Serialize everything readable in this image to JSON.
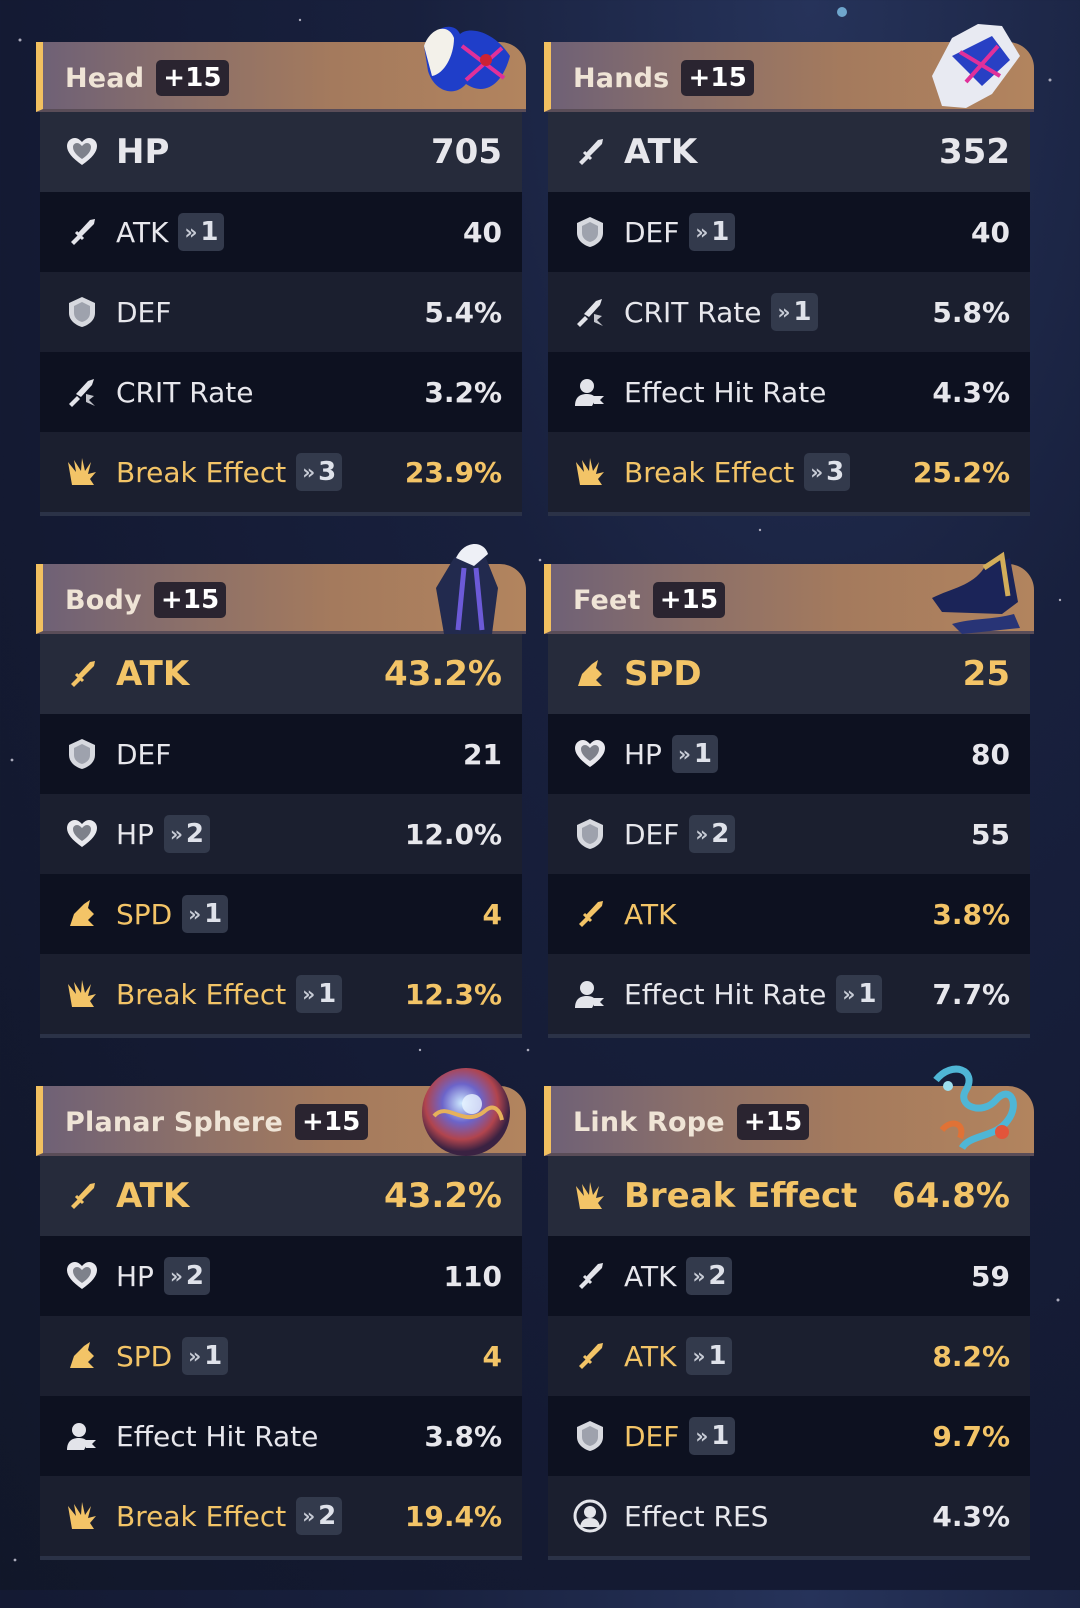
{
  "accent_gold": "#f3c467",
  "relics": [
    {
      "slot": "Head",
      "level": "+15",
      "art_icon": "mask-icon",
      "stats": [
        {
          "icon": "hp-icon",
          "name": "HP",
          "value": "705",
          "rolls": null,
          "highlight": false
        },
        {
          "icon": "atk-icon",
          "name": "ATK",
          "value": "40",
          "rolls": "1",
          "highlight": false
        },
        {
          "icon": "def-icon",
          "name": "DEF",
          "value": "5.4%",
          "rolls": null,
          "highlight": false
        },
        {
          "icon": "crit-rate-icon",
          "name": "CRIT Rate",
          "value": "3.2%",
          "rolls": null,
          "highlight": false
        },
        {
          "icon": "break-effect-icon",
          "name": "Break Effect",
          "value": "23.9%",
          "rolls": "3",
          "highlight": true
        }
      ]
    },
    {
      "slot": "Hands",
      "level": "+15",
      "art_icon": "gloves-icon",
      "stats": [
        {
          "icon": "atk-icon",
          "name": "ATK",
          "value": "352",
          "rolls": null,
          "highlight": false
        },
        {
          "icon": "def-icon",
          "name": "DEF",
          "value": "40",
          "rolls": "1",
          "highlight": false
        },
        {
          "icon": "crit-rate-icon",
          "name": "CRIT Rate",
          "value": "5.8%",
          "rolls": "1",
          "highlight": false
        },
        {
          "icon": "effect-hit-rate-icon",
          "name": "Effect Hit Rate",
          "value": "4.3%",
          "rolls": null,
          "highlight": false
        },
        {
          "icon": "break-effect-icon",
          "name": "Break Effect",
          "value": "25.2%",
          "rolls": "3",
          "highlight": true
        }
      ]
    },
    {
      "slot": "Body",
      "level": "+15",
      "art_icon": "coat-icon",
      "stats": [
        {
          "icon": "atk-icon",
          "name": "ATK",
          "value": "43.2%",
          "rolls": null,
          "highlight": true
        },
        {
          "icon": "def-icon",
          "name": "DEF",
          "value": "21",
          "rolls": null,
          "highlight": false
        },
        {
          "icon": "hp-icon",
          "name": "HP",
          "value": "12.0%",
          "rolls": "2",
          "highlight": false
        },
        {
          "icon": "spd-icon",
          "name": "SPD",
          "value": "4",
          "rolls": "1",
          "highlight": true
        },
        {
          "icon": "break-effect-icon",
          "name": "Break Effect",
          "value": "12.3%",
          "rolls": "1",
          "highlight": true
        }
      ]
    },
    {
      "slot": "Feet",
      "level": "+15",
      "art_icon": "shoes-icon",
      "stats": [
        {
          "icon": "spd-icon",
          "name": "SPD",
          "value": "25",
          "rolls": null,
          "highlight": true
        },
        {
          "icon": "hp-icon",
          "name": "HP",
          "value": "80",
          "rolls": "1",
          "highlight": false
        },
        {
          "icon": "def-icon",
          "name": "DEF",
          "value": "55",
          "rolls": "2",
          "highlight": false
        },
        {
          "icon": "atk-icon",
          "name": "ATK",
          "value": "3.8%",
          "rolls": null,
          "highlight": true
        },
        {
          "icon": "effect-hit-rate-icon",
          "name": "Effect Hit Rate",
          "value": "7.7%",
          "rolls": "1",
          "highlight": false
        }
      ]
    },
    {
      "slot": "Planar Sphere",
      "level": "+15",
      "art_icon": "sphere-icon",
      "stats": [
        {
          "icon": "atk-icon",
          "name": "ATK",
          "value": "43.2%",
          "rolls": null,
          "highlight": true
        },
        {
          "icon": "hp-icon",
          "name": "HP",
          "value": "110",
          "rolls": "2",
          "highlight": false
        },
        {
          "icon": "spd-icon",
          "name": "SPD",
          "value": "4",
          "rolls": "1",
          "highlight": true
        },
        {
          "icon": "effect-hit-rate-icon",
          "name": "Effect Hit Rate",
          "value": "3.8%",
          "rolls": null,
          "highlight": false
        },
        {
          "icon": "break-effect-icon",
          "name": "Break Effect",
          "value": "19.4%",
          "rolls": "2",
          "highlight": true
        }
      ]
    },
    {
      "slot": "Link Rope",
      "level": "+15",
      "art_icon": "rope-icon",
      "stats": [
        {
          "icon": "break-effect-icon",
          "name": "Break Effect",
          "value": "64.8%",
          "rolls": null,
          "highlight": true
        },
        {
          "icon": "atk-icon",
          "name": "ATK",
          "value": "59",
          "rolls": "2",
          "highlight": false
        },
        {
          "icon": "atk-icon",
          "name": "ATK",
          "value": "8.2%",
          "rolls": "1",
          "highlight": true
        },
        {
          "icon": "def-icon",
          "name": "DEF",
          "value": "9.7%",
          "rolls": "1",
          "highlight": true
        },
        {
          "icon": "effect-res-icon",
          "name": "Effect RES",
          "value": "4.3%",
          "rolls": null,
          "highlight": false
        }
      ]
    }
  ]
}
